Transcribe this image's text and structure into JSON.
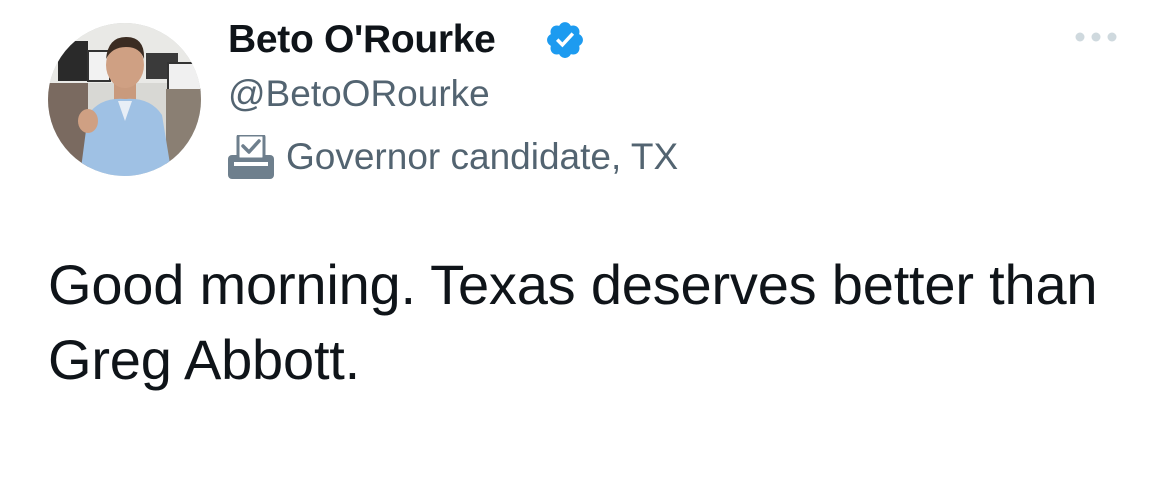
{
  "author": {
    "display_name": "Beto O'Rourke",
    "handle": "@BetoORourke",
    "verified": true,
    "avatar_icon": "profile-photo",
    "label_icon": "ballot-box-icon",
    "label": "Governor candidate, TX"
  },
  "menu": {
    "icon": "more-options-icon"
  },
  "tweet": {
    "text": "Good morning. Texas deserves better than Greg Abbott."
  },
  "colors": {
    "text_primary": "#0f1419",
    "text_secondary": "#536471",
    "verified_blue": "#1d9bf0",
    "more_icon_gray": "#cfd9de"
  }
}
